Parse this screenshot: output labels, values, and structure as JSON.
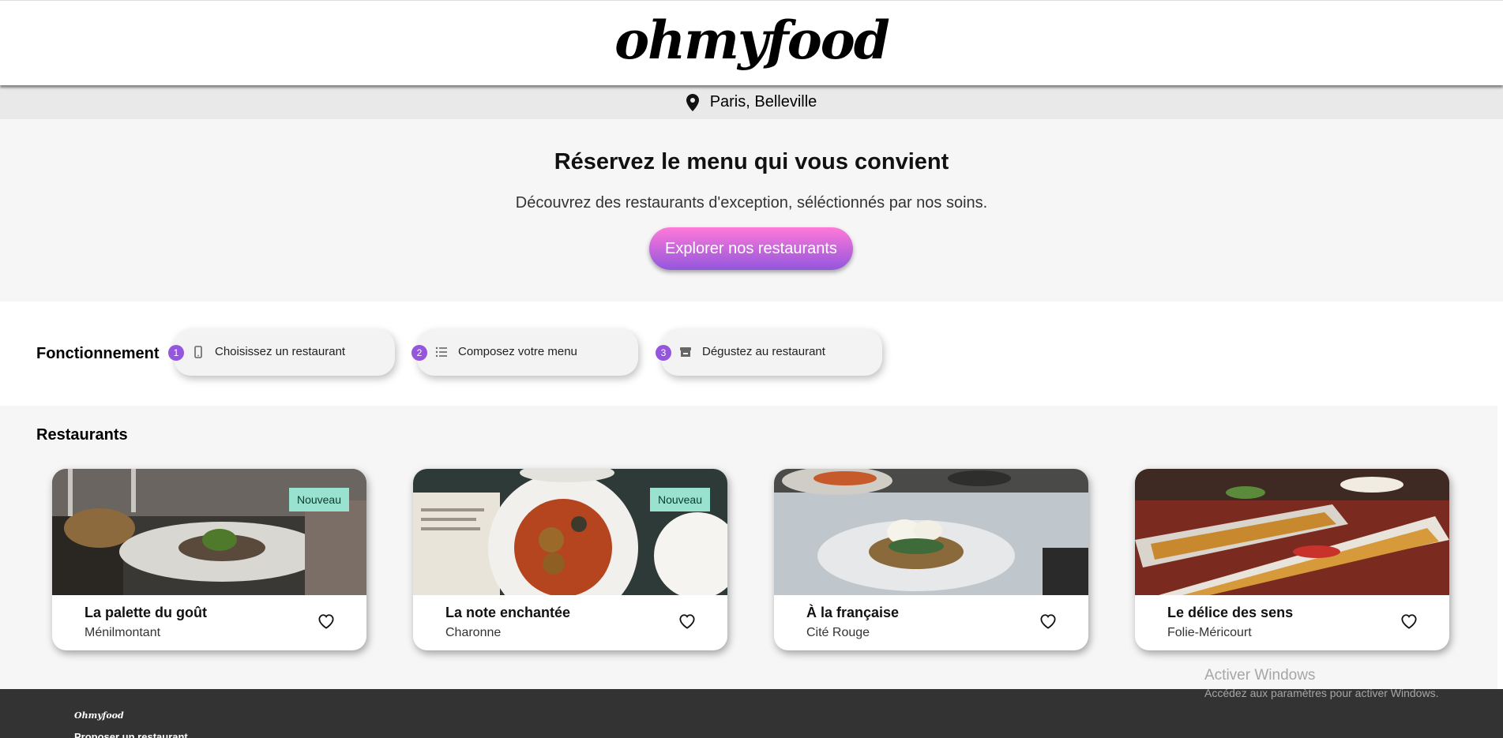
{
  "header": {
    "logo": "ohmyfood"
  },
  "location": {
    "icon": "map-pin-icon",
    "text": "Paris, Belleville"
  },
  "hero": {
    "title": "Réservez le menu qui vous convient",
    "subtitle": "Découvrez des restaurants d'exception, séléctionnés par nos soins.",
    "cta_label": "Explorer nos restaurants",
    "cta_colors": [
      "#ff79da",
      "#9356dc"
    ]
  },
  "how": {
    "title": "Fonctionnement",
    "steps": [
      {
        "number": "1",
        "icon": "phone-icon",
        "label": "Choisissez un restaurant"
      },
      {
        "number": "2",
        "icon": "list-icon",
        "label": "Composez votre menu"
      },
      {
        "number": "3",
        "icon": "store-icon",
        "label": "Dégustez au restaurant"
      }
    ]
  },
  "restaurants": {
    "title": "Restaurants",
    "items": [
      {
        "name": "La palette du goût",
        "area": "Ménilmontant",
        "badge": "Nouveau"
      },
      {
        "name": "La note enchantée",
        "area": "Charonne",
        "badge": "Nouveau"
      },
      {
        "name": "À la française",
        "area": "Cité Rouge",
        "badge": ""
      },
      {
        "name": "Le délice des sens",
        "area": "Folie-Méricourt",
        "badge": ""
      }
    ]
  },
  "watermark": {
    "line1": "Activer Windows",
    "line2": "Accédez aux paramètres pour activer Windows."
  },
  "footer": {
    "logo": "Ohmyfood",
    "link": "Proposer un restaurant"
  },
  "colors": {
    "accent": "#9356dc",
    "badge": "#99e2d0",
    "footer": "#333333"
  }
}
